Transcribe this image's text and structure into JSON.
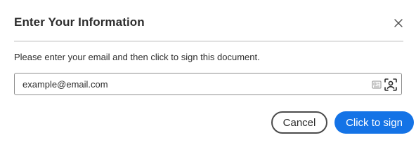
{
  "dialog": {
    "title": "Enter Your Information",
    "instruction": "Please enter your email and then click to sign this document."
  },
  "email_field": {
    "value": "example@email.com",
    "placeholder": "example@email.com"
  },
  "buttons": {
    "cancel_label": "Cancel",
    "sign_label": "Click to sign"
  },
  "icons": {
    "close": "close-icon",
    "card": "id-card-icon",
    "contact": "contact-scan-icon"
  },
  "colors": {
    "accent": "#1473e6",
    "text": "#2c2c2c",
    "border": "#8e8e8e",
    "divider": "#e1e1e1"
  }
}
